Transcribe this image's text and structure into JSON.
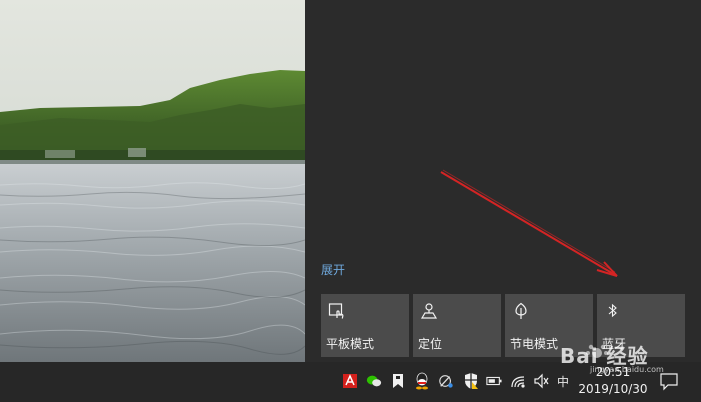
{
  "action_center": {
    "expand_label": "展开",
    "tiles": [
      {
        "label": "平板模式",
        "icon": "tablet-mode-icon"
      },
      {
        "label": "定位",
        "icon": "location-icon"
      },
      {
        "label": "节电模式",
        "icon": "battery-saver-icon"
      },
      {
        "label": "蓝牙",
        "icon": "bluetooth-icon"
      }
    ]
  },
  "taskbar": {
    "ime": "中",
    "time": "20:51",
    "date": "2019/10/30",
    "tray_icons": [
      "adobe-icon",
      "wechat-icon",
      "bookmark-icon",
      "qq-icon",
      "speaker-tool-icon",
      "security-shield-icon",
      "battery-icon",
      "wifi-icon",
      "volume-icon"
    ]
  },
  "watermark": {
    "text": "Bai 经验",
    "sub": "jingyan.baidu.com"
  },
  "colors": {
    "panel": "#2b2b2b",
    "tile": "#4b4b4b",
    "taskbar": "#272727",
    "link": "#6fa8dc",
    "arrow": "#d42424"
  }
}
